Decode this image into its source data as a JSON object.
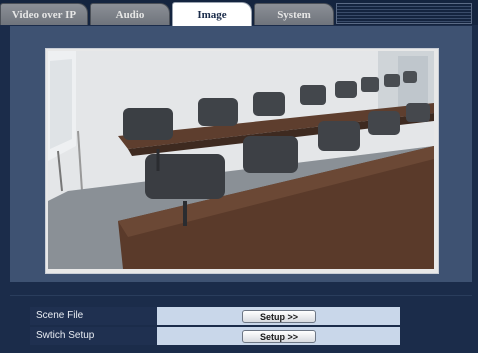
{
  "tabs": [
    {
      "label": "Video over IP",
      "active": false
    },
    {
      "label": "Audio",
      "active": false
    },
    {
      "label": "Image",
      "active": true
    },
    {
      "label": "System",
      "active": false
    }
  ],
  "viewer": {
    "scene": "conference-room-camera-view"
  },
  "settings": [
    {
      "label": "Scene File",
      "button": "Setup >>"
    },
    {
      "label": "Swtich Setup",
      "button": "Setup >>"
    }
  ],
  "colors": {
    "background": "#1b2c4a",
    "panel": "#3e5272",
    "row_label_bg": "#1f3050",
    "row_value_bg": "#c9d7ea",
    "active_tab": "#ffffff"
  }
}
